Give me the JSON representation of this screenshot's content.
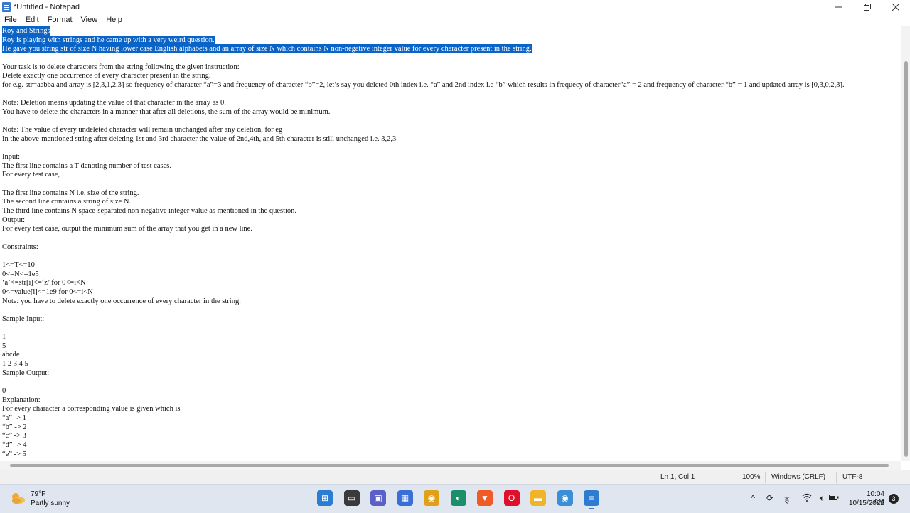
{
  "window": {
    "title": "*Untitled - Notepad"
  },
  "menu": [
    "File",
    "Edit",
    "Format",
    "View",
    "Help"
  ],
  "editor": {
    "lines": [
      {
        "text": "Roy and Strings",
        "selected": true
      },
      {
        "text": "Roy is playing with strings and he came up with a very weird question.",
        "selected": true
      },
      {
        "text": "He gave you string str of size N having lower case English alphabets and an array of size N which contains N non-negative integer value for every character present in the string.",
        "selected": true
      },
      {
        "text": "",
        "selected": false
      },
      {
        "text": "Your task is to delete characters from the string following the given instruction:",
        "selected": false
      },
      {
        "text": "Delete exactly one occurrence of every character present in the string.",
        "selected": false
      },
      {
        "text": "for e.g. str=aabba and array is [2,3,1,2,3] so frequency of character “a”=3 and frequency of character “b”=2, let’s say you deleted 0th index i.e. “a” and 2nd index i.e “b” which results in frequecy of character”a” = 2 and frequency of character “b” = 1 and updated array is [0,3,0,2,3].",
        "selected": false
      },
      {
        "text": "",
        "selected": false
      },
      {
        "text": "Note: Deletion means updating the value of that character in the array as 0.",
        "selected": false
      },
      {
        "text": "You have to delete the characters in a manner that after all deletions, the sum of the array would be minimum.",
        "selected": false
      },
      {
        "text": "",
        "selected": false
      },
      {
        "text": "Note: The value of every undeleted character will remain unchanged after any deletion, for eg",
        "selected": false
      },
      {
        "text": "In the above-mentioned string after deleting 1st and 3rd character the value of 2nd,4th, and 5th character is still unchanged i.e. 3,2,3",
        "selected": false
      },
      {
        "text": "",
        "selected": false
      },
      {
        "text": "Input:",
        "selected": false
      },
      {
        "text": "The first line contains a T-denoting number of test cases.",
        "selected": false
      },
      {
        "text": "For every test case,",
        "selected": false
      },
      {
        "text": "",
        "selected": false
      },
      {
        "text": "The first line contains N i.e. size of the string.",
        "selected": false
      },
      {
        "text": "The second line contains a string of size N.",
        "selected": false
      },
      {
        "text": "The third line contains N space-separated non-negative integer value as mentioned in the question.",
        "selected": false
      },
      {
        "text": "Output:",
        "selected": false
      },
      {
        "text": "For every test case, output the minimum sum of the array that you get in a new line.",
        "selected": false
      },
      {
        "text": "",
        "selected": false
      },
      {
        "text": "Constraints:",
        "selected": false
      },
      {
        "text": "",
        "selected": false
      },
      {
        "text": "1<=T<=10",
        "selected": false
      },
      {
        "text": "0<=N<=1e5",
        "selected": false
      },
      {
        "text": "‘a’<=str[i]<=‘z’ for 0<=i<N",
        "selected": false
      },
      {
        "text": "0<=value[i]<=1e9 for 0<=i<N",
        "selected": false
      },
      {
        "text": "Note: you have to delete exactly one occurrence of every character in the string.",
        "selected": false
      },
      {
        "text": "",
        "selected": false
      },
      {
        "text": "Sample Input:",
        "selected": false
      },
      {
        "text": "",
        "selected": false
      },
      {
        "text": "1",
        "selected": false
      },
      {
        "text": "5",
        "selected": false
      },
      {
        "text": "abcde",
        "selected": false
      },
      {
        "text": "1 2 3 4 5",
        "selected": false
      },
      {
        "text": "Sample Output:",
        "selected": false
      },
      {
        "text": "",
        "selected": false
      },
      {
        "text": "0",
        "selected": false
      },
      {
        "text": "Explanation:",
        "selected": false
      },
      {
        "text": "For every character a corresponding value is given which is",
        "selected": false
      },
      {
        "text": "“a” -> 1",
        "selected": false
      },
      {
        "text": "“b” -> 2",
        "selected": false
      },
      {
        "text": "“c” -> 3",
        "selected": false
      },
      {
        "text": "“d” -> 4",
        "selected": false
      },
      {
        "text": "“e” -> 5",
        "selected": false
      }
    ]
  },
  "status": {
    "position": "Ln 1, Col 1",
    "zoom": "100%",
    "line_ending": "Windows (CRLF)",
    "encoding": "UTF-8"
  },
  "taskbar": {
    "weather_temp": "79°F",
    "weather_desc": "Partly sunny",
    "time": "10:04 AM",
    "date": "10/15/2022",
    "notification_count": "3",
    "apps": [
      {
        "name": "start-button",
        "icon": "windows-logo-icon",
        "color": "#2b7cd3"
      },
      {
        "name": "task-view-button",
        "icon": "task-view-icon",
        "color": "#3a3a3a"
      },
      {
        "name": "teams-chat-button",
        "icon": "teams-icon",
        "color": "#5b5fc7"
      },
      {
        "name": "store-button",
        "icon": "store-icon",
        "color": "#3a6fd8"
      },
      {
        "name": "chrome-button",
        "icon": "chrome-icon",
        "color": "#e0a01a"
      },
      {
        "name": "edge-button",
        "icon": "edge-icon",
        "color": "#1a8f6a"
      },
      {
        "name": "brave-button",
        "icon": "brave-icon",
        "color": "#f05a24"
      },
      {
        "name": "opera-button",
        "icon": "opera-icon",
        "color": "#e0102a"
      },
      {
        "name": "file-explorer-button",
        "icon": "folder-icon",
        "color": "#f0b429"
      },
      {
        "name": "chrome-profile-button",
        "icon": "chrome-icon",
        "color": "#3b8fd6"
      },
      {
        "name": "notepad-button",
        "icon": "notepad-icon",
        "color": "#2f7bd0"
      }
    ]
  }
}
